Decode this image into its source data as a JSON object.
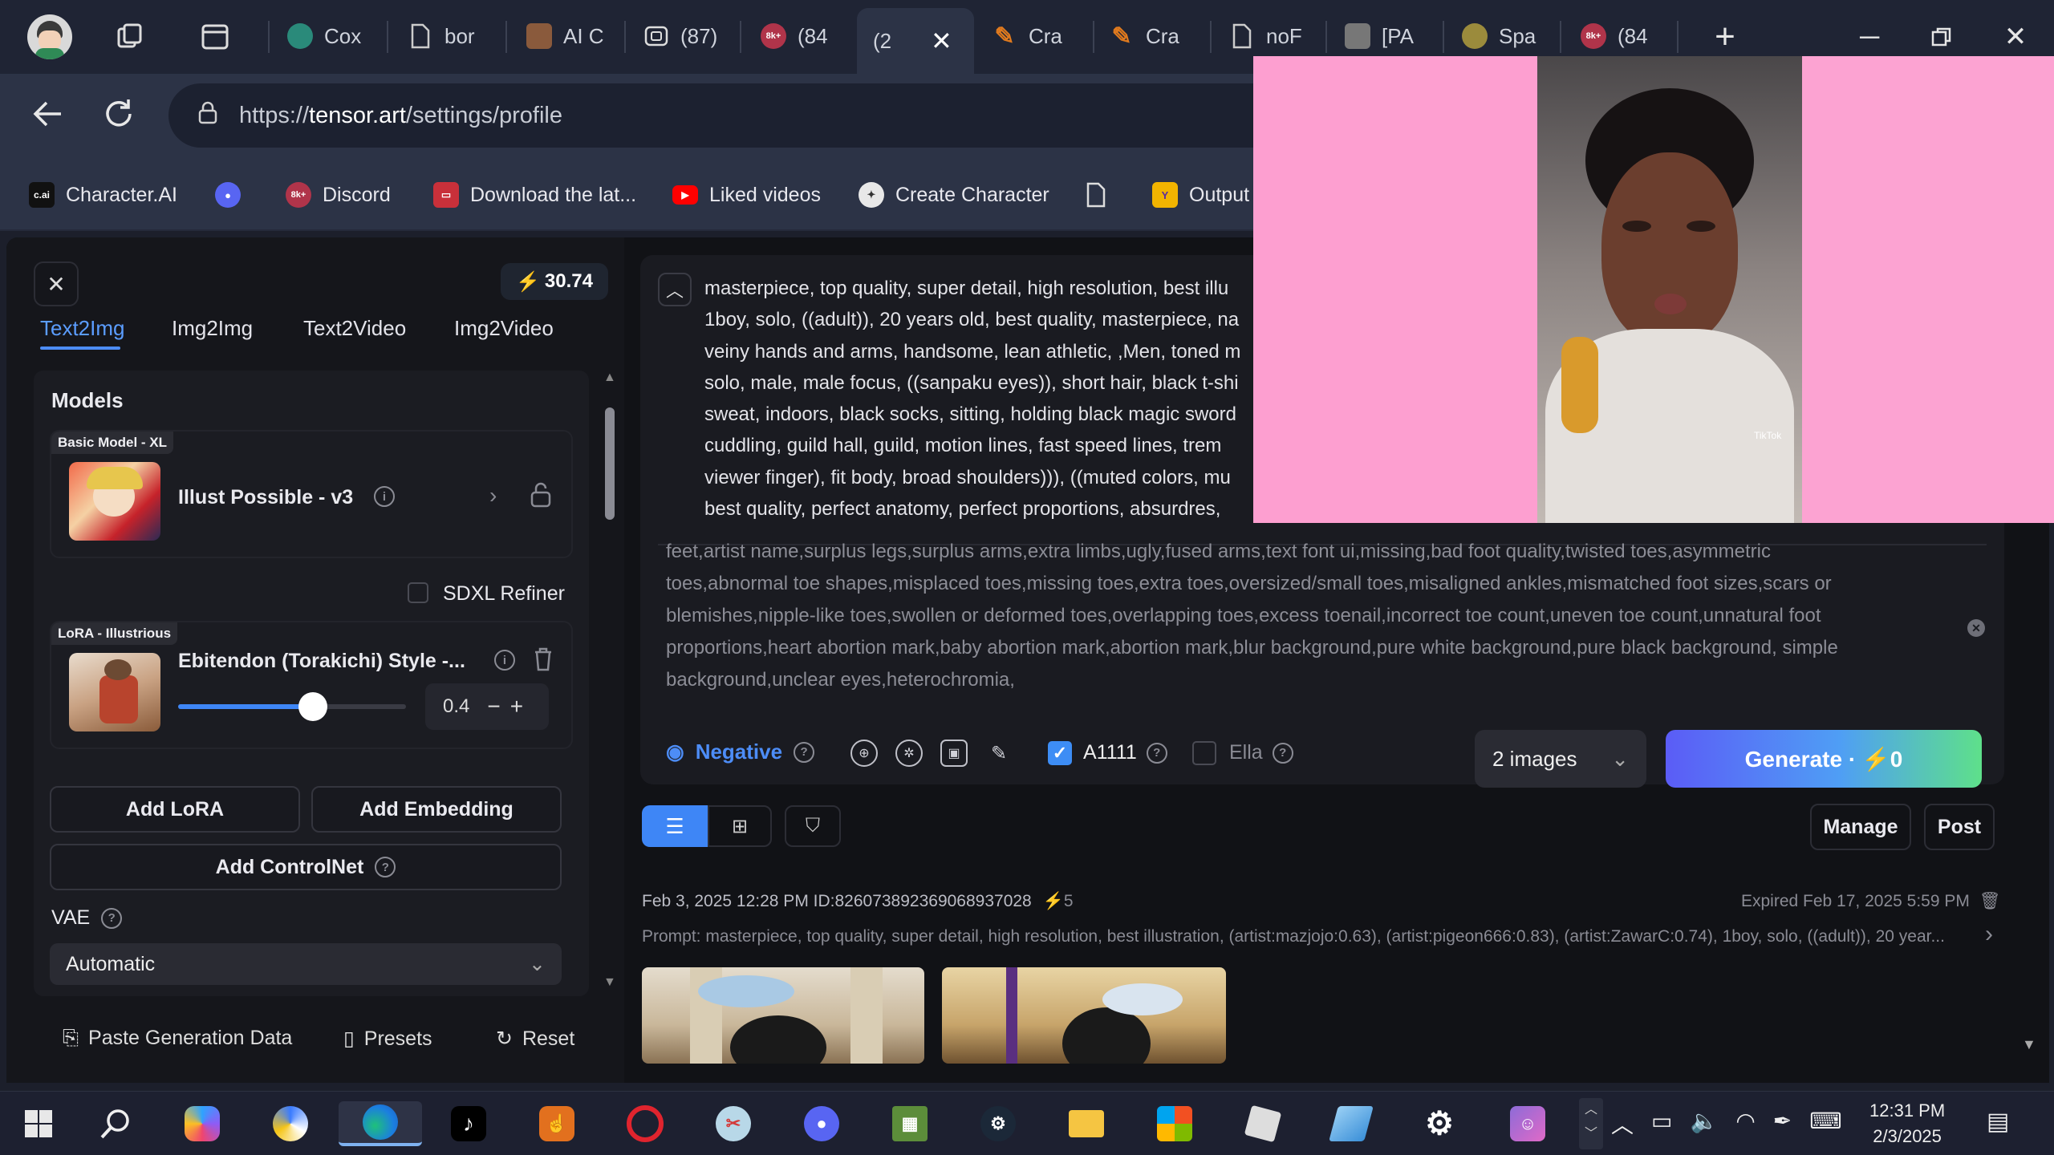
{
  "browser": {
    "tabs": [
      {
        "label": "Cox",
        "fav_color": "#2a8a7a"
      },
      {
        "label": "bor",
        "fav_color": "#3b4152"
      },
      {
        "label": "AI C",
        "fav_color": "#8a5a3c"
      },
      {
        "label": "(87)",
        "fav_color": "#3b4152"
      },
      {
        "label": "(84",
        "fav_color": "#b0344a"
      },
      {
        "label": "(2",
        "fav_color": "#2c3346"
      },
      {
        "label": "Cra",
        "fav_color": "#e07a1e"
      },
      {
        "label": "Cra",
        "fav_color": "#e07a1e"
      },
      {
        "label": "noF",
        "fav_color": "#3b4152"
      },
      {
        "label": "[PA",
        "fav_color": "#777"
      },
      {
        "label": "Spa",
        "fav_color": "#9b8b3c"
      },
      {
        "label": "(84",
        "fav_color": "#b0344a"
      }
    ],
    "url_prefix": "https://",
    "url_domain": "tensor.art",
    "url_path": "/settings/profile",
    "bookmarks": [
      {
        "label": "Character.AI",
        "icon": "c.ai"
      },
      {
        "label": "",
        "icon": "discord"
      },
      {
        "label": "Discord",
        "icon": "8k+"
      },
      {
        "label": "Download the lat...",
        "icon": "dl"
      },
      {
        "label": "Liked videos",
        "icon": "yt"
      },
      {
        "label": "Create Character",
        "icon": "cc"
      },
      {
        "label": "",
        "icon": "doc"
      },
      {
        "label": "Output",
        "icon": "out"
      }
    ]
  },
  "left": {
    "credits": "30.74",
    "tabs": [
      "Text2Img",
      "Img2Img",
      "Text2Video",
      "Img2Video"
    ],
    "models_heading": "Models",
    "base_badge": "Basic Model - XL",
    "base_name": "Illust Possible - v3",
    "sdxl_refiner": "SDXL Refiner",
    "lora_badge": "LoRA - Illustrious",
    "lora_name": "Ebitendon (Torakichi) Style -...",
    "lora_weight": "0.4",
    "lora_weight_fraction": 0.59,
    "add_lora": "Add LoRA",
    "add_embedding": "Add Embedding",
    "add_controlnet": "Add ControlNet",
    "vae_label": "VAE",
    "vae_value": "Automatic",
    "paste": "Paste Generation Data",
    "presets": "Presets",
    "reset": "Reset"
  },
  "prompt": {
    "lines": [
      "masterpiece, top quality, super detail, high resolution, best illu",
      "1boy, solo, ((adult)), 20 years old, best quality, masterpiece, na",
      "veiny hands and arms, handsome, lean athletic, ,Men, toned m",
      "solo, male, male focus, ((sanpaku eyes)), short hair, black t-shi",
      "sweat, indoors, black socks, sitting, holding black magic sword",
      "cuddling, guild hall, guild, motion lines, fast speed lines, trem",
      "viewer finger), fit body, broad shoulders))), ((muted colors, mu",
      "best quality, perfect anatomy, perfect proportions, absurdres,"
    ],
    "negative_lines": [
      "feet,artist name,surplus legs,surplus arms,extra limbs,ugly,fused arms,text font ui,missing,bad foot quality,twisted toes,asymmetric",
      "toes,abnormal toe shapes,misplaced toes,missing toes,extra toes,oversized/small toes,misaligned ankles,mismatched foot sizes,scars or",
      "blemishes,nipple-like toes,swollen or deformed toes,overlapping toes,excess toenail,incorrect toe count,uneven toe count,unnatural foot",
      "proportions,heart abortion mark,baby abortion mark,abortion mark,blur background,pure white background,pure black background, simple",
      "background,unclear eyes,heterochromia,"
    ],
    "negative_label": "Negative",
    "a1111": "A1111",
    "ella": "Ella",
    "images_select": "2 images",
    "generate": "Generate · ⚡0"
  },
  "results": {
    "manage": "Manage",
    "post": "Post",
    "meta": "Feb 3, 2025 12:28 PM ID:826073892369068937028",
    "cost": "⚡5",
    "expired": "Expired Feb 17, 2025 5:59 PM",
    "prompt_line": "Prompt: masterpiece, top quality, super detail, high resolution, best illustration, (artist:mazjojo:0.63), (artist:pigeon666:0.83), (artist:ZawarC:0.74), 1boy, solo, ((adult)), 20 year..."
  },
  "video": {
    "watermark": "TikTok"
  },
  "taskbar": {
    "time": "12:31 PM",
    "date": "2/3/2025"
  }
}
